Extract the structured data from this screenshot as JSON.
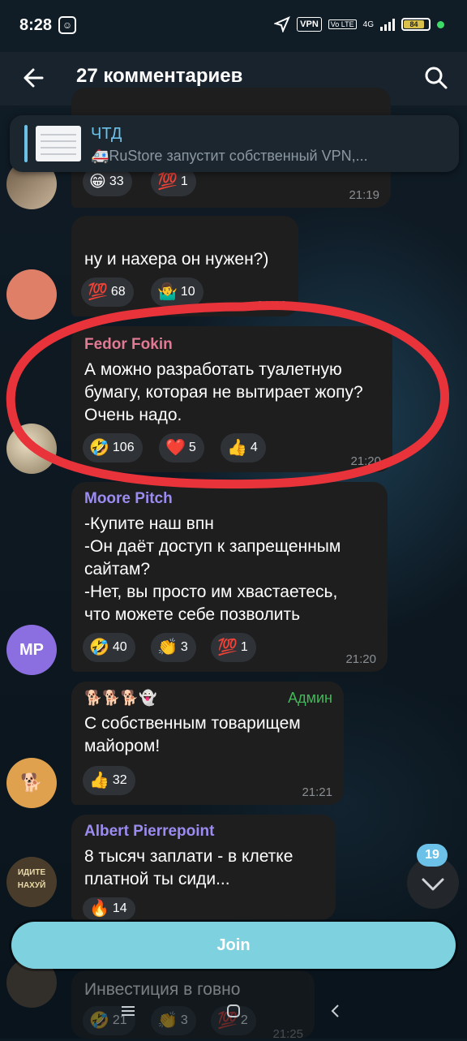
{
  "status_bar": {
    "time": "8:28",
    "vpn_label": "VPN",
    "network": "4G",
    "battery_level": "84",
    "battery_fraction": 0.84
  },
  "header": {
    "title": "27 комментариев"
  },
  "pinned": {
    "title": "ЧТД",
    "text": "🚑RuStore запустит собственный VPN,..."
  },
  "messages": [
    {
      "id": "m0",
      "text": "",
      "reactions": [
        {
          "emoji": "😁",
          "count": "33"
        },
        {
          "emoji": "💯",
          "count": "1"
        }
      ],
      "time": "21:19"
    },
    {
      "id": "m1",
      "text": "ну и нахера он нужен?)",
      "reactions": [
        {
          "emoji": "💯",
          "count": "68"
        },
        {
          "emoji": "🤷‍♂️",
          "count": "10"
        }
      ],
      "time": "21:19"
    },
    {
      "id": "m2",
      "sender": "Fedor Fokin",
      "sender_color": "#e27a94",
      "text": "А можно разработать туалетную бумагу, которая не вытирает жопу? Очень надо.",
      "reactions": [
        {
          "emoji": "🤣",
          "count": "106"
        },
        {
          "emoji": "❤️",
          "count": "5"
        },
        {
          "emoji": "👍",
          "count": "4"
        }
      ],
      "time": "21:20"
    },
    {
      "id": "m3",
      "sender": "Moore Pitch",
      "sender_color": "#9a8cf0",
      "avatar_initials": "MP",
      "text_lines": [
        "-Купите наш впн",
        "-Он даёт доступ к запрещенным",
        "сайтам?",
        "-Нет, вы просто им хвастаетесь,",
        "что можете себе позволить"
      ],
      "reactions": [
        {
          "emoji": "🤣",
          "count": "40"
        },
        {
          "emoji": "👏",
          "count": "3"
        },
        {
          "emoji": "💯",
          "count": "1"
        }
      ],
      "time": "21:20"
    },
    {
      "id": "m4",
      "sender": "🐕🐕🐕👻",
      "badge": "Админ",
      "text": "С собственным товарищем майором!",
      "reactions": [
        {
          "emoji": "👍",
          "count": "32"
        }
      ],
      "time": "21:21"
    },
    {
      "id": "m5",
      "sender": "Albert Pierrepoint",
      "sender_color": "#9a8cf0",
      "avatar_text": "ИДИТЕ НАХУЙ",
      "text": "8 тысяч заплати - в клетке платной ты сиди...",
      "reactions": [
        {
          "emoji": "🔥",
          "count": "14"
        }
      ]
    },
    {
      "id": "m6",
      "text": "Инвестиция в говно",
      "reactions": [
        {
          "emoji": "🤣",
          "count": "21"
        },
        {
          "emoji": "👏",
          "count": "3"
        },
        {
          "emoji": "💯",
          "count": "2"
        }
      ],
      "time": "21:25"
    }
  ],
  "scroll_button": {
    "unread_count": "19"
  },
  "join_button": {
    "label": "Join"
  },
  "colors": {
    "accent": "#6bc1e8",
    "join": "#7ed1de",
    "admin": "#43b85a",
    "annotation": "#e8333a"
  }
}
